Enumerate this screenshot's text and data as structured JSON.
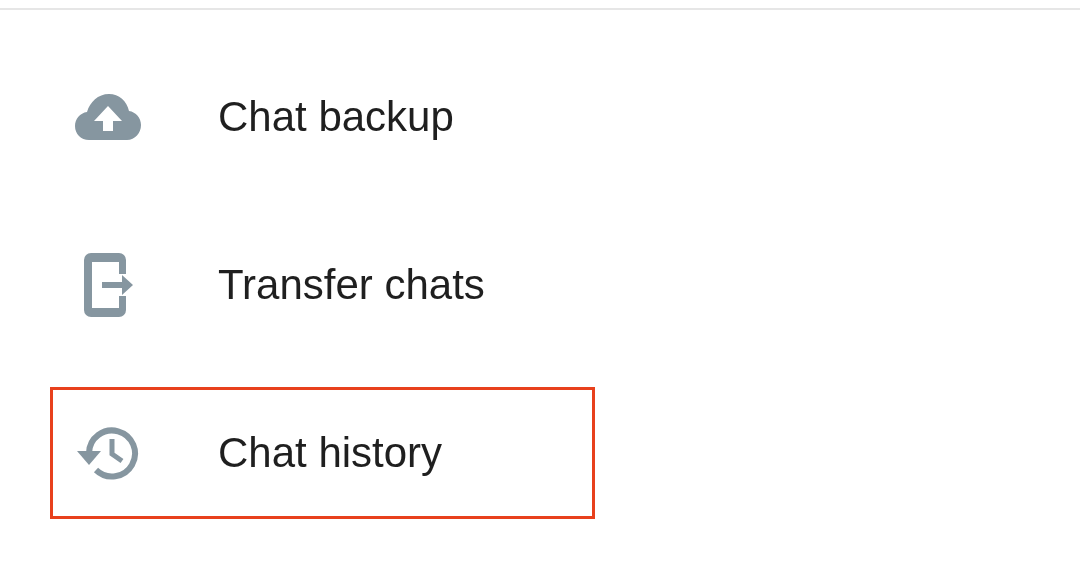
{
  "items": [
    {
      "label": "Chat backup",
      "highlighted": false
    },
    {
      "label": "Transfer chats",
      "highlighted": false
    },
    {
      "label": "Chat history",
      "highlighted": true
    }
  ]
}
